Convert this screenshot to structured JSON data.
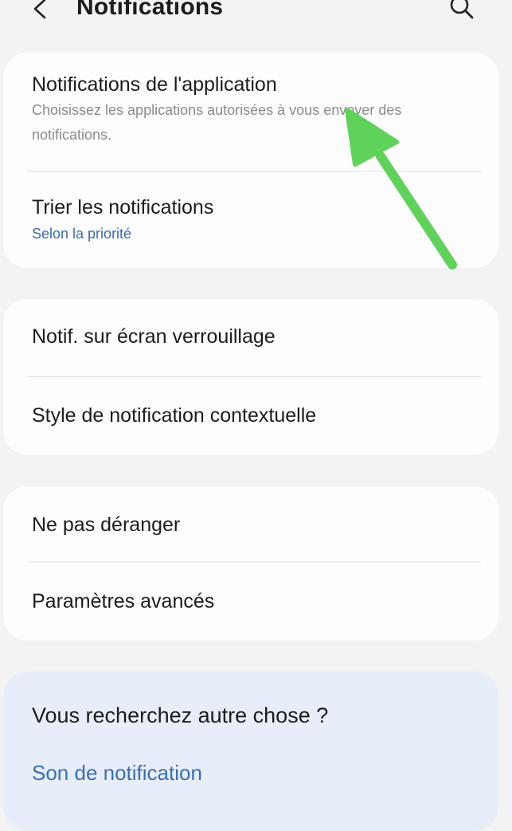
{
  "header": {
    "title": "Notifications",
    "back_icon": "chevron-left-icon",
    "search_icon": "search-icon"
  },
  "group1": {
    "app_notifications": {
      "title": "Notifications de l'application",
      "subtitle": "Choisissez les applications autorisées à vous envoyer des notifications."
    },
    "sort_notifications": {
      "title": "Trier les notifications",
      "value": "Selon la priorité"
    }
  },
  "group2": {
    "lock_screen": {
      "title": "Notif. sur écran verrouillage"
    },
    "popup_style": {
      "title": "Style de notification contextuelle"
    }
  },
  "group3": {
    "do_not_disturb": {
      "title": "Ne pas déranger"
    },
    "advanced": {
      "title": "Paramètres avancés"
    }
  },
  "suggestions": {
    "title": "Vous recherchez autre chose ?",
    "link": "Son de notification"
  },
  "colors": {
    "background": "#f3f3f3",
    "card": "#fdfdfd",
    "suggestion_card": "#e8eef9",
    "link_blue": "#3a6eb5",
    "annotation_arrow": "#5fd25a"
  }
}
